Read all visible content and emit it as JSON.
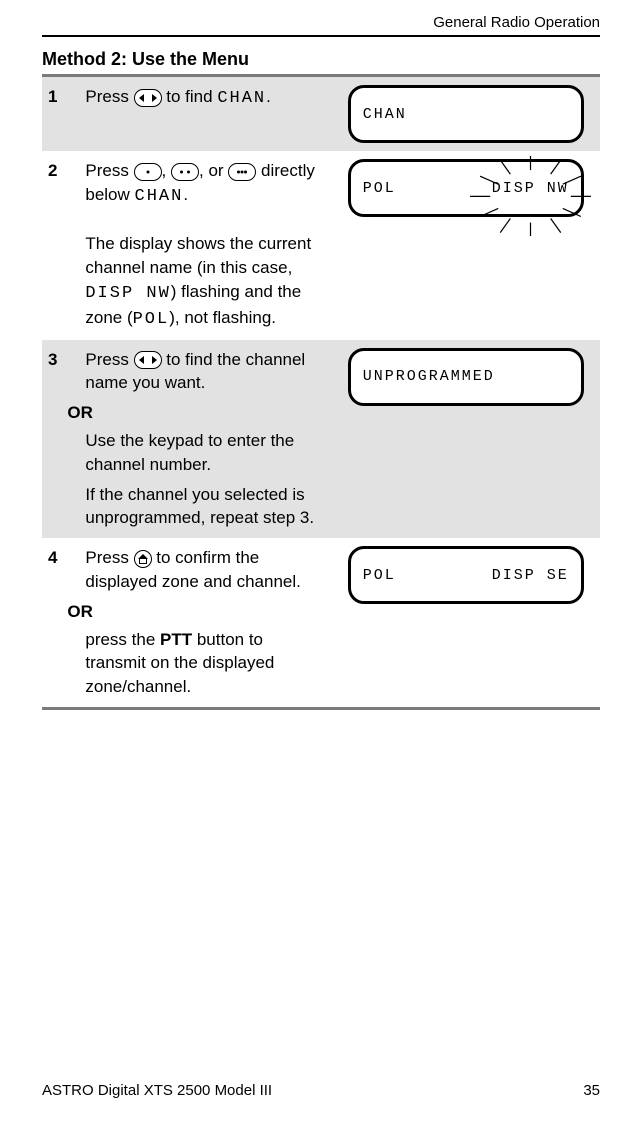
{
  "header": {
    "running": "General Radio Operation"
  },
  "title": "Method 2: Use the Menu",
  "steps": [
    {
      "num": "1",
      "pre": "Press ",
      "post_pre": " to find ",
      "code1": "CHAN",
      "post": ".",
      "lcd": {
        "line1_left": "CHAN"
      }
    },
    {
      "num": "2",
      "pre": "Press ",
      "sep1": ", ",
      "sep2": ", or ",
      "after_btns": " directly below ",
      "code1": "CHAN",
      "after_code1": ".",
      "para2_a": "The display shows the current channel name (in this case, ",
      "para2_code": "DISP NW",
      "para2_b": ") flashing and the zone (",
      "para2_code2": "POL",
      "para2_c": "), not flashing.",
      "lcd": {
        "left": "POL",
        "right": "DISP NW"
      }
    },
    {
      "num": "3",
      "pre": "Press ",
      "post_pre": " to find the channel name you want.",
      "or": "OR",
      "p2": "Use the keypad to enter the channel number.",
      "p3": "If the channel you selected is unprogrammed, repeat step 3.",
      "lcd": {
        "line1_left": "UNPROGRAMMED"
      }
    },
    {
      "num": "4",
      "pre": "Press ",
      "post_pre": " to confirm the displayed zone and channel.",
      "or": "OR",
      "p2_a": "press the ",
      "p2_bold": "PTT",
      "p2_b": " button to transmit on the displayed zone/channel.",
      "lcd": {
        "left": "POL",
        "right": "DISP SE"
      }
    }
  ],
  "footer": {
    "left": "ASTRO Digital XTS 2500  Model III",
    "page": "35"
  }
}
